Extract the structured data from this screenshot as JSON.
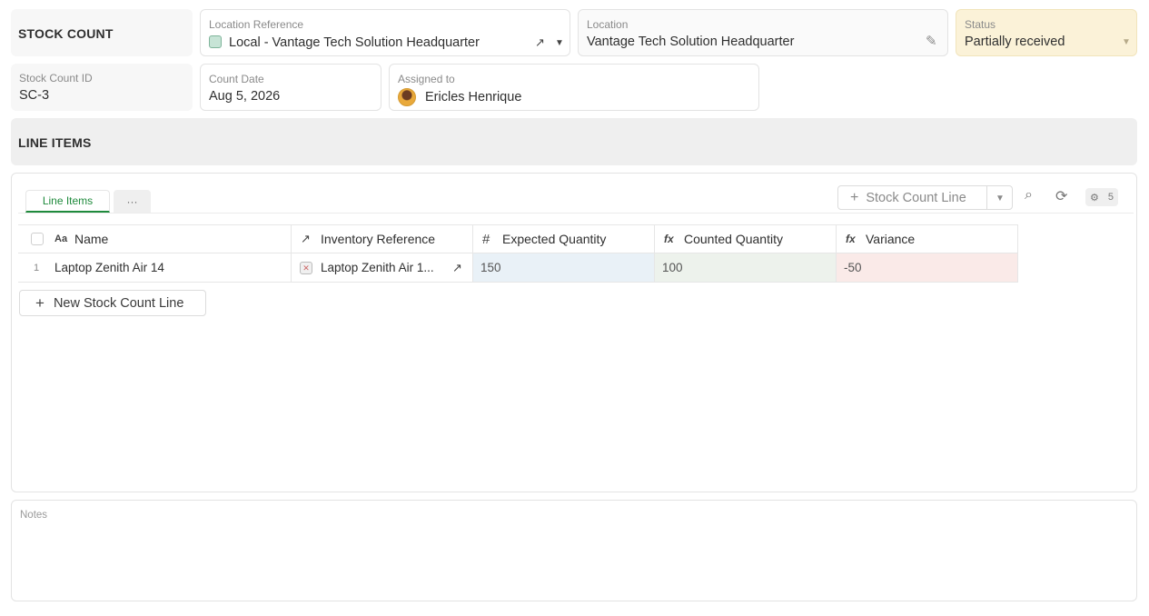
{
  "header": {
    "title": "STOCK COUNT"
  },
  "fields": {
    "location_reference": {
      "label": "Location Reference",
      "value": "Local - Vantage Tech Solution Headquarter"
    },
    "location": {
      "label": "Location",
      "value": "Vantage Tech Solution Headquarter"
    },
    "status": {
      "label": "Status",
      "value": "Partially received"
    },
    "stock_count_id": {
      "label": "Stock Count ID",
      "value": "SC-3"
    },
    "count_date": {
      "label": "Count Date",
      "value": "Aug 5, 2026"
    },
    "assigned_to": {
      "label": "Assigned to",
      "value": "Ericles Henrique"
    }
  },
  "line_items_section": {
    "title": "LINE ITEMS",
    "tabs": [
      {
        "label": "Line Items"
      },
      {
        "label": "···"
      }
    ],
    "toolbar": {
      "add_label": "Stock Count Line",
      "fields_count": "5"
    },
    "columns": [
      {
        "icon": "Aa",
        "label": "Name"
      },
      {
        "icon": "↗",
        "label": "Inventory Reference"
      },
      {
        "icon": "#",
        "label": "Expected Quantity"
      },
      {
        "icon": "fx",
        "label": "Counted Quantity"
      },
      {
        "icon": "fx",
        "label": "Variance"
      }
    ],
    "rows": [
      {
        "index": "1",
        "name": "Laptop Zenith Air 14",
        "inventory_reference": "Laptop Zenith Air 1...",
        "expected": "150",
        "counted": "100",
        "variance": "-50"
      }
    ],
    "new_line_label": "New Stock Count Line"
  },
  "notes": {
    "label": "Notes",
    "value": ""
  },
  "colors": {
    "status_bg": "#fbf2d8",
    "expected_bg": "#e9f1f7",
    "counted_bg": "#edf2ec",
    "variance_bg": "#faeae8",
    "tab_active": "#1f8a3c"
  }
}
